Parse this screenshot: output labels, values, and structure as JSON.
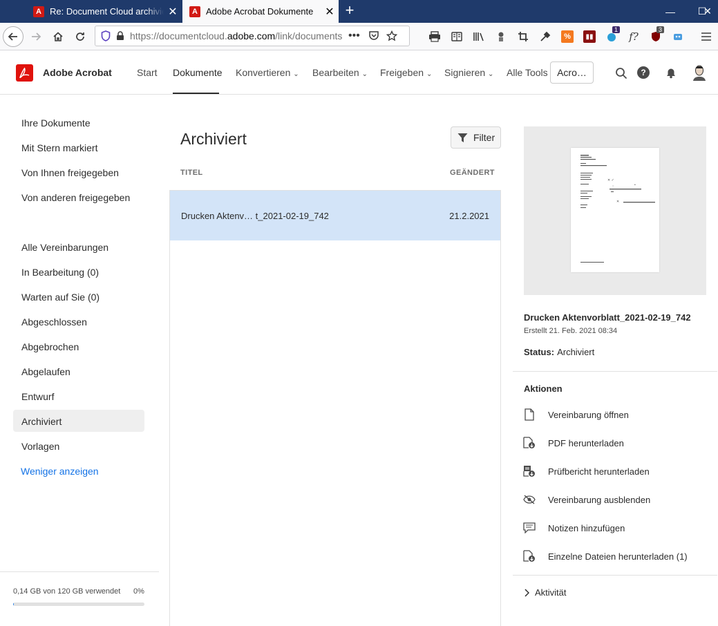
{
  "browser": {
    "tabs": [
      {
        "title": "Re: Document Cloud archiviert",
        "active": false
      },
      {
        "title": "Adobe Acrobat Dokumente",
        "active": true
      }
    ],
    "url_prefix": "https://documentcloud.",
    "url_host": "adobe.com",
    "url_path": "/link/documents",
    "badges": {
      "notifications": "1",
      "ublock": "3"
    },
    "window_controls": {
      "minimize": "—",
      "maximize": "☐",
      "close": "✕"
    }
  },
  "header": {
    "brand": "Adobe Acrobat",
    "menu": [
      {
        "label": "Start",
        "dropdown": false
      },
      {
        "label": "Dokumente",
        "dropdown": false,
        "active": true
      },
      {
        "label": "Konvertieren",
        "dropdown": true
      },
      {
        "label": "Bearbeiten",
        "dropdown": true
      },
      {
        "label": "Freigeben",
        "dropdown": true
      },
      {
        "label": "Signieren",
        "dropdown": true
      },
      {
        "label": "Alle Tools",
        "dropdown": false
      }
    ],
    "acro_button": "Acro…"
  },
  "sidebar": {
    "items": [
      "Ihre Dokumente",
      "Mit Stern markiert",
      "Von Ihnen freigegeben",
      "Von anderen freigegeben",
      "Alle Vereinbarungen",
      "In Bearbeitung (0)",
      "Warten auf Sie (0)",
      "Abgeschlossen",
      "Abgebrochen",
      "Abgelaufen",
      "Entwurf",
      "Archiviert",
      "Vorlagen"
    ],
    "selected": "Archiviert",
    "show_less": "Weniger anzeigen",
    "storage_text": "0,14 GB von 120 GB verwendet",
    "storage_percent": "0%",
    "storage_fraction": 0.0012
  },
  "main": {
    "title": "Archiviert",
    "filter_label": "Filter",
    "col_title": "TITEL",
    "col_changed": "GEÄNDERT",
    "rows": [
      {
        "title": "Drucken Aktenv… t_2021-02-19_742",
        "date": "21.2.2021"
      }
    ]
  },
  "details": {
    "name": "Drucken Aktenvorblatt_2021-02-19_742",
    "created": "Erstellt 21. Feb. 2021 08:34",
    "status_label": "Status:",
    "status_value": "Archiviert",
    "actions_title": "Aktionen",
    "actions": [
      {
        "label": "Vereinbarung öffnen",
        "icon": "document-icon"
      },
      {
        "label": "PDF herunterladen",
        "icon": "pdf-download-icon"
      },
      {
        "label": "Prüfbericht herunterladen",
        "icon": "audit-report-download-icon"
      },
      {
        "label": "Vereinbarung ausblenden",
        "icon": "hide-eye-icon"
      },
      {
        "label": "Notizen hinzufügen",
        "icon": "comment-icon"
      },
      {
        "label": "Einzelne Dateien herunterladen (1)",
        "icon": "file-download-icon"
      }
    ],
    "activity": "Aktivität"
  }
}
